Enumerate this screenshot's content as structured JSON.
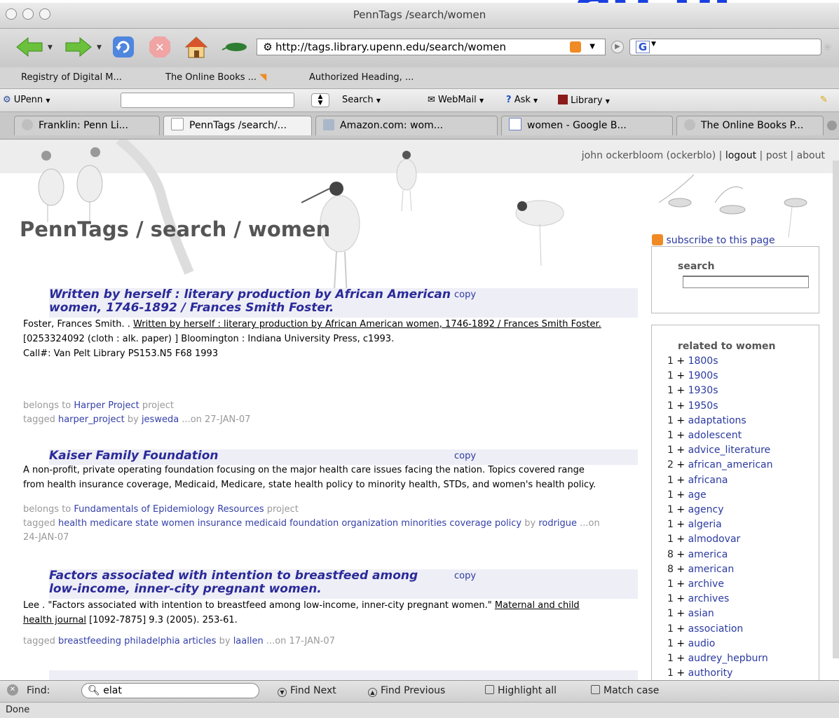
{
  "window": {
    "title": "PennTags /search/women"
  },
  "navbar": {
    "url": "http://tags.library.upenn.edu/search/women",
    "search_engine_letter": "G"
  },
  "bookmarks": [
    {
      "label": "Registry of Digital M..."
    },
    {
      "label": "The Online Books ..."
    },
    {
      "label": "Authorized Heading, ..."
    }
  ],
  "pennbar": {
    "upenn": "UPenn",
    "search": "Search",
    "webmail": "WebMail",
    "ask": "Ask",
    "library": "Library"
  },
  "tabs": [
    {
      "label": "Franklin: Penn Li..."
    },
    {
      "label": "PennTags /search/..."
    },
    {
      "label": "Amazon.com: wom..."
    },
    {
      "label": "women - Google B..."
    },
    {
      "label": "The Online Books P..."
    }
  ],
  "user": {
    "name": "john ockerbloom (ockerblo)",
    "logout": "logout",
    "post": "post",
    "about": "about"
  },
  "page_title": "PennTags / search / women",
  "copy_label": "copy",
  "entries": [
    {
      "title_line1": "Written by herself : literary production by African American",
      "title_line2": "women, 1746-1892 / Frances Smith Foster.",
      "citation_prefix": "Foster, Frances Smith. . ",
      "citation_link": "Written by herself : literary production by African American women, 1746-1892 / Frances Smith Foster.",
      "line2": "[0253324092 (cloth : alk. paper) ] Bloomington : Indiana University Press, c1993.",
      "line3": "Call#: Van Pelt Library PS153.N5 F68 1993",
      "belongs_prefix": "belongs to ",
      "project": "Harper Project",
      "belongs_suffix": " project",
      "tagged_prefix": "tagged ",
      "tags": "harper_project",
      "by": " by ",
      "user": "jesweda",
      "date": " ...on 27-JAN-07"
    },
    {
      "title": "Kaiser Family Foundation",
      "desc1": "A non-profit, private operating foundation focusing on the major health care issues facing the nation. Topics covered range",
      "desc2": "from health insurance coverage, Medicaid, Medicare, state health policy to minority health, STDs, and women's health policy.",
      "belongs_prefix": "belongs to ",
      "project": "Fundamentals of Epidemiology Resources",
      "belongs_suffix": " project",
      "tagged_prefix": "tagged ",
      "tags": "health medicare state women insurance medicaid foundation organization minorities coverage policy",
      "by": " by ",
      "user": "rodrigue",
      "date1": " ...on",
      "date2": "24-JAN-07"
    },
    {
      "title_line1": "Factors associated with intention to breastfeed among",
      "title_line2": "low-income, inner-city pregnant women.",
      "citation_prefix": "Lee . \"Factors associated with intention to breastfeed among low-income, inner-city pregnant women.\" ",
      "journal_a": "Maternal and child",
      "journal_b": "health journal",
      "citation_suffix": " [1092-7875] 9.3 (2005). 253-61.",
      "tagged_prefix": "tagged ",
      "tags": "breastfeeding philadelphia articles",
      "by": " by ",
      "user": "laallen",
      "date": " ...on 17-JAN-07"
    }
  ],
  "sidebar": {
    "subscribe": "subscribe to this page",
    "search_label": "search",
    "related_label": "related to women",
    "related": [
      {
        "count": "1",
        "tag": "1800s"
      },
      {
        "count": "1",
        "tag": "1900s"
      },
      {
        "count": "1",
        "tag": "1930s"
      },
      {
        "count": "1",
        "tag": "1950s"
      },
      {
        "count": "1",
        "tag": "adaptations"
      },
      {
        "count": "1",
        "tag": "adolescent"
      },
      {
        "count": "1",
        "tag": "advice_literature"
      },
      {
        "count": "2",
        "tag": "african_american"
      },
      {
        "count": "1",
        "tag": "africana"
      },
      {
        "count": "1",
        "tag": "age"
      },
      {
        "count": "1",
        "tag": "agency"
      },
      {
        "count": "1",
        "tag": "algeria"
      },
      {
        "count": "1",
        "tag": "almodovar"
      },
      {
        "count": "8",
        "tag": "america"
      },
      {
        "count": "8",
        "tag": "american"
      },
      {
        "count": "1",
        "tag": "archive"
      },
      {
        "count": "1",
        "tag": "archives"
      },
      {
        "count": "1",
        "tag": "asian"
      },
      {
        "count": "1",
        "tag": "association"
      },
      {
        "count": "1",
        "tag": "audio"
      },
      {
        "count": "1",
        "tag": "audrey_hepburn"
      },
      {
        "count": "1",
        "tag": "authority"
      }
    ]
  },
  "findbar": {
    "find_label": "Find:",
    "query": "elat",
    "find_next": "Find Next",
    "find_previous": "Find Previous",
    "highlight_all": "Highlight all",
    "match_case": "Match case"
  },
  "status": "Done"
}
